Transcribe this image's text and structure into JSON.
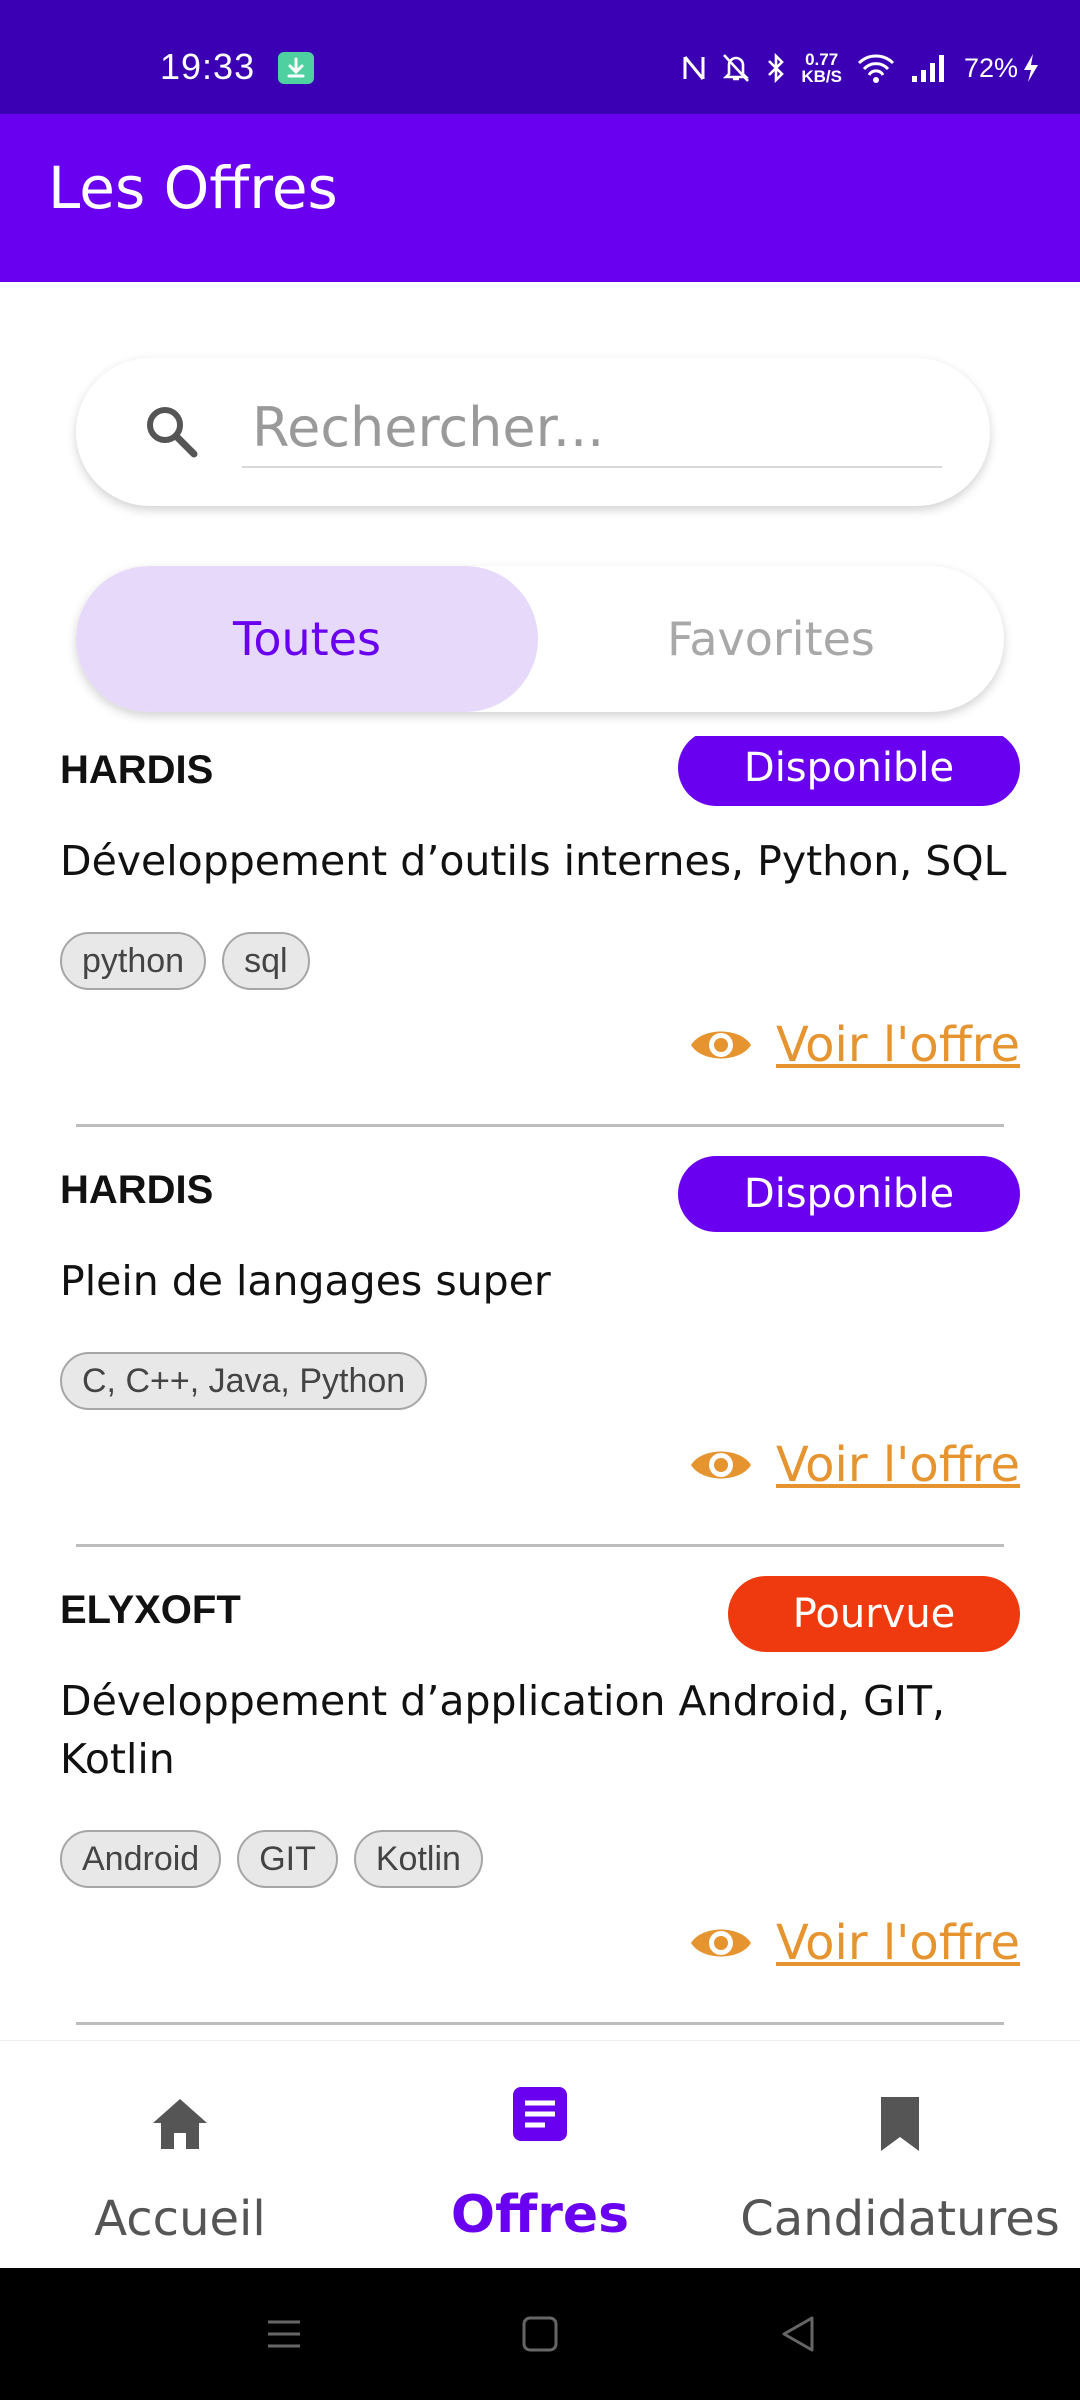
{
  "status_bar": {
    "time": "19:33",
    "net_speed_value": "0.77",
    "net_speed_unit": "KB/S",
    "battery": "72%",
    "icons": [
      "download-icon",
      "nfc-icon",
      "mute-icon",
      "bluetooth-icon",
      "wifi-icon",
      "signal-icon",
      "charging-icon"
    ]
  },
  "app_bar": {
    "title": "Les Offres"
  },
  "search": {
    "placeholder": "Rechercher..."
  },
  "tabs": [
    {
      "label": "Toutes",
      "selected": true
    },
    {
      "label": "Favorites",
      "selected": false
    }
  ],
  "colors": {
    "primary": "#6a00f0",
    "status_bar": "#3c00b4",
    "available": "#6a00f0",
    "filled": "#ee3a0e",
    "link": "#e69430"
  },
  "offers": [
    {
      "company": "HARDIS",
      "status": "Disponible",
      "description": "Développement d’outils internes, Python, SQL",
      "tags": [
        "python",
        "sql"
      ],
      "link": "Voir l'offre"
    },
    {
      "company": "HARDIS",
      "status": "Disponible",
      "description": "Plein de langages super",
      "tags": [
        "C, C++, Java, Python"
      ],
      "link": "Voir l'offre"
    },
    {
      "company": "ELYXOFT",
      "status": "Pourvue",
      "description": "Développement d’application Android, GIT, Kotlin",
      "tags": [
        "Android",
        "GIT",
        "Kotlin"
      ],
      "link": "Voir l'offre"
    }
  ],
  "bottom_nav": [
    {
      "label": "Accueil",
      "icon": "home-icon",
      "active": false
    },
    {
      "label": "Offres",
      "icon": "document-icon",
      "active": true
    },
    {
      "label": "Candidatures",
      "icon": "bookmark-icon",
      "active": false
    }
  ]
}
